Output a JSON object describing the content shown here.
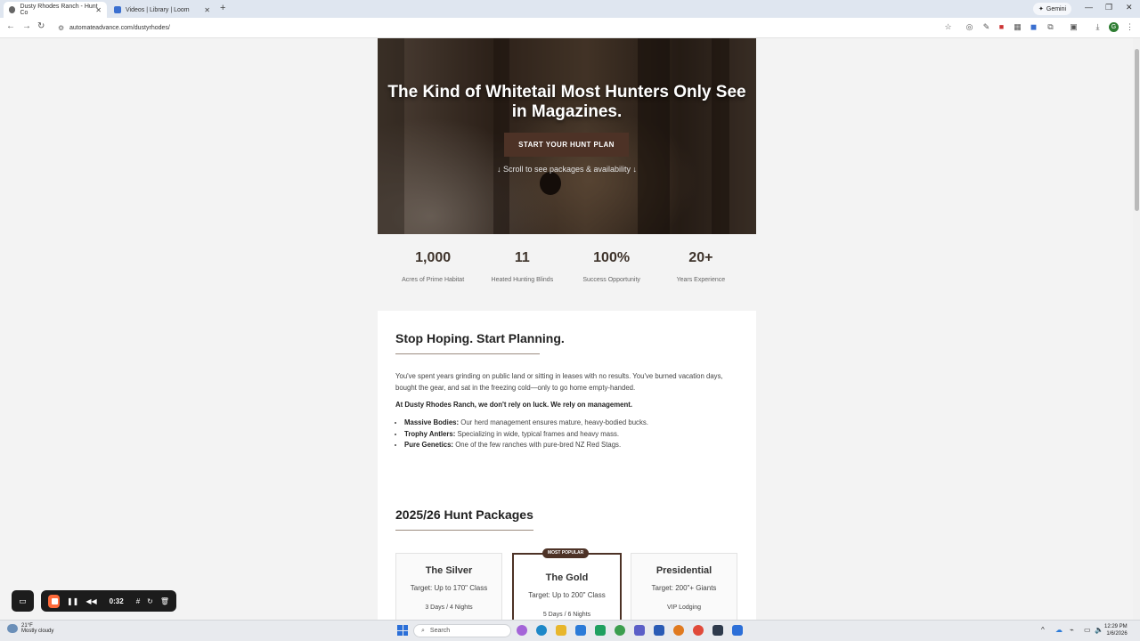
{
  "browser": {
    "tabs": [
      {
        "label": "Dusty Rhodes Ranch - Hunt Co",
        "active": true
      },
      {
        "label": "Videos | Library | Loom",
        "active": false
      }
    ],
    "new_tab": "+",
    "gemini_label": "Gemini",
    "url": "automateadvance.com/dustyrhodes/"
  },
  "hero": {
    "title": "The Kind of Whitetail Most Hunters Only See in Magazines.",
    "cta_label": "START YOUR HUNT PLAN",
    "scroll_hint": "↓ Scroll to see packages & availability ↓"
  },
  "stats": [
    {
      "value": "1,000",
      "label": "Acres of Prime Habitat"
    },
    {
      "value": "11",
      "label": "Heated Hunting Blinds"
    },
    {
      "value": "100%",
      "label": "Success Opportunity"
    },
    {
      "value": "20+",
      "label": "Years Experience"
    }
  ],
  "intro": {
    "heading": "Stop Hoping. Start Planning.",
    "paragraph": "You've spent years grinding on public land or sitting in leases with no results. You've burned vacation days, bought the gear, and sat in the freezing cold—only to go home empty-handed.",
    "statement": "At Dusty Rhodes Ranch, we don't rely on luck. We rely on management.",
    "bullets": [
      {
        "term": "Massive Bodies:",
        "text": " Our herd management ensures mature, heavy-bodied bucks."
      },
      {
        "term": "Trophy Antlers:",
        "text": " Specializing in wide, typical frames and heavy mass."
      },
      {
        "term": "Pure Genetics:",
        "text": " One of the few ranches with pure-bred NZ Red Stags."
      }
    ]
  },
  "packages": {
    "heading": "2025/26 Hunt Packages",
    "badge": "MOST POPULAR",
    "cards": [
      {
        "name": "The Silver",
        "target": "Target: Up to 170\" Class",
        "extra": "3 Days / 4 Nights"
      },
      {
        "name": "The Gold",
        "target": "Target: Up to 200\" Class",
        "extra": "5 Days / 6 Nights"
      },
      {
        "name": "Presidential",
        "target": "Target: 200\"+ Giants",
        "extra": "VIP Lodging"
      }
    ]
  },
  "loom": {
    "time": "0:32"
  },
  "taskbar": {
    "temp": "21°F",
    "condition": "Mostly cloudy",
    "search_placeholder": "Search",
    "time": "12:29 PM",
    "date": "1/6/2026"
  }
}
